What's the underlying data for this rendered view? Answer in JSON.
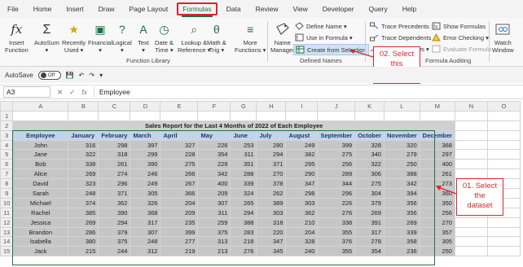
{
  "ribbon_tabs": [
    "File",
    "Home",
    "Insert",
    "Draw",
    "Page Layout",
    "Formulas",
    "Data",
    "Review",
    "View",
    "Developer",
    "Query",
    "Help"
  ],
  "active_tab": "Formulas",
  "function_library": {
    "label": "Function Library",
    "buttons": [
      {
        "label": "Insert\nFunction",
        "icon": "fx-icon"
      },
      {
        "label": "AutoSum\n▾",
        "icon": "sigma-icon"
      },
      {
        "label": "Recently\nUsed ▾",
        "icon": "star-book-icon"
      },
      {
        "label": "Financial\n▾",
        "icon": "financial-book-icon"
      },
      {
        "label": "Logical\n▾",
        "icon": "logical-book-icon"
      },
      {
        "label": "Text\n▾",
        "icon": "text-book-icon"
      },
      {
        "label": "Date &\nTime ▾",
        "icon": "clock-book-icon"
      },
      {
        "label": "Lookup &\nReference ▾",
        "icon": "lookup-book-icon"
      },
      {
        "label": "Math &\nTrig ▾",
        "icon": "math-book-icon"
      },
      {
        "label": "More\nFunctions ▾",
        "icon": "more-book-icon"
      }
    ]
  },
  "defined_names": {
    "label": "Defined Names",
    "name_manager": "Name\nManager",
    "define_name": "Define Name ▾",
    "use_in_formula": "Use in Formula ▾",
    "create_from_selection": "Create from Selection"
  },
  "formula_auditing": {
    "label": "Formula Auditing",
    "trace_precedents": "Trace Precedents",
    "trace_dependents": "Trace Dependents",
    "remove_arrows": "Remove Arrows ▾",
    "show_formulas": "Show Formulas",
    "error_checking": "Error Checking ▾",
    "evaluate_formula": "Evaluate Formula",
    "watch_window": "Watch\nWindow"
  },
  "qat": {
    "autosave_label": "AutoSave",
    "autosave_state": "Off"
  },
  "formula_bar": {
    "name_box": "A3",
    "value": "Employee"
  },
  "callouts": {
    "select_option": "02. Select\nthis\noption",
    "select_dataset": "01. Select\nthe\ndataset"
  },
  "sheet": {
    "columns": [
      "A",
      "B",
      "C",
      "D",
      "E",
      "F",
      "G",
      "H",
      "I",
      "J",
      "K",
      "L",
      "M",
      "N",
      "O"
    ],
    "title": "Sales Report for the Last 4 Months of 2022 of Each Employee",
    "headers": [
      "Employee",
      "January",
      "February",
      "March",
      "April",
      "May",
      "June",
      "July",
      "August",
      "September",
      "October",
      "November",
      "December"
    ],
    "rows": [
      [
        "John",
        316,
        298,
        397,
        327,
        226,
        253,
        280,
        249,
        399,
        328,
        320,
        368
      ],
      [
        "Jane",
        322,
        318,
        299,
        228,
        354,
        311,
        294,
        382,
        275,
        340,
        279,
        297
      ],
      [
        "Bob",
        338,
        261,
        390,
        275,
        229,
        351,
        371,
        295,
        256,
        322,
        250,
        400
      ],
      [
        "Alice",
        269,
        274,
        246,
        266,
        342,
        288,
        270,
        290,
        289,
        306,
        388,
        261
      ],
      [
        "David",
        323,
        296,
        249,
        267,
        400,
        339,
        378,
        347,
        344,
        275,
        342,
        273
      ],
      [
        "Sarah",
        248,
        371,
        305,
        366,
        209,
        324,
        262,
        298,
        296,
        304,
        394,
        360
      ],
      [
        "Michael",
        374,
        362,
        326,
        204,
        307,
        265,
        389,
        303,
        226,
        379,
        356,
        350
      ],
      [
        "Rachel",
        385,
        390,
        368,
        209,
        311,
        294,
        303,
        362,
        276,
        269,
        356,
        256
      ],
      [
        "Jessica",
        269,
        294,
        317,
        235,
        259,
        388,
        318,
        210,
        338,
        391,
        269,
        270
      ],
      [
        "Brandon",
        286,
        379,
        307,
        399,
        375,
        283,
        220,
        204,
        355,
        317,
        339,
        357
      ],
      [
        "Isabella",
        380,
        375,
        248,
        277,
        313,
        218,
        347,
        328,
        376,
        278,
        358,
        305
      ],
      [
        "Jack",
        215,
        244,
        312,
        219,
        213,
        276,
        345,
        240,
        355,
        354,
        236,
        250
      ]
    ]
  }
}
